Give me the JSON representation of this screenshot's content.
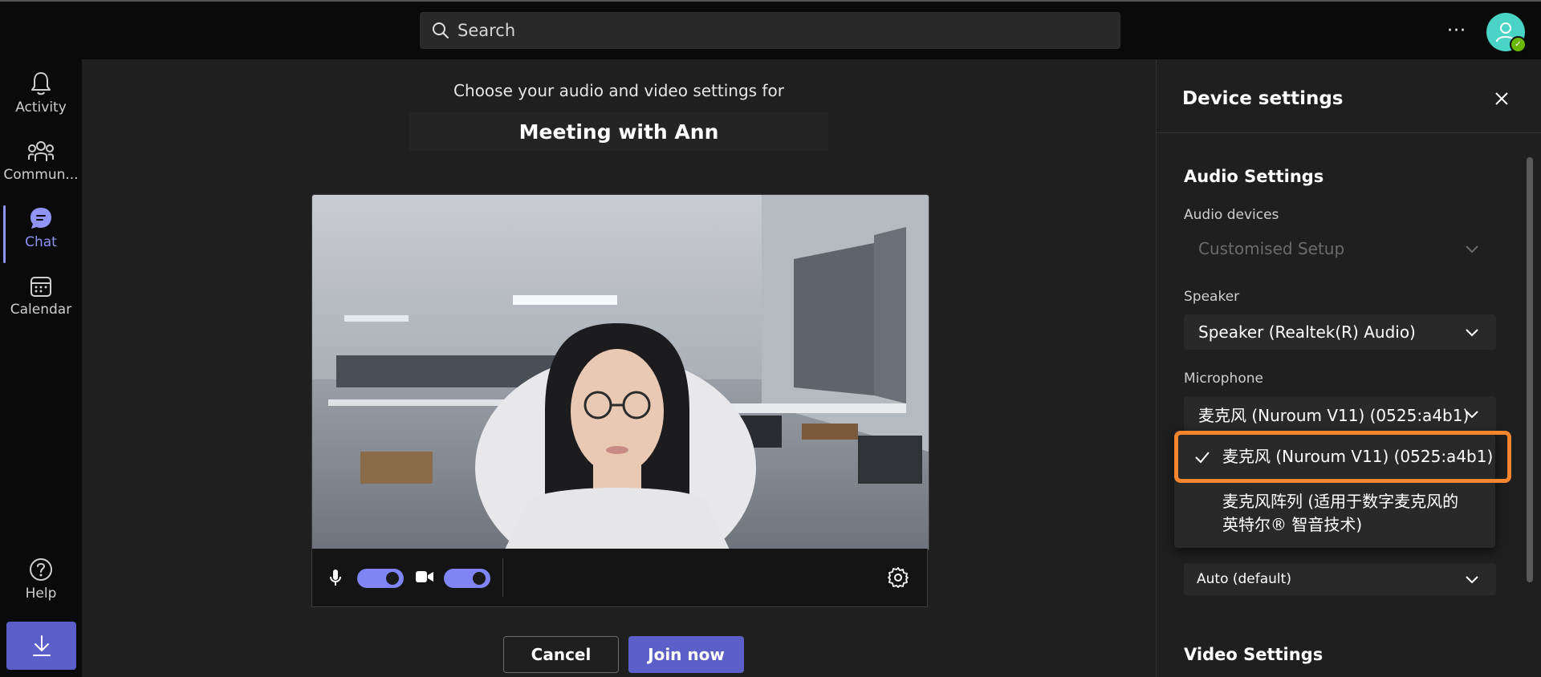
{
  "header": {
    "search_placeholder": "Search",
    "more_label": "···"
  },
  "rail": {
    "items": [
      {
        "label": "Activity",
        "icon": "bell-icon"
      },
      {
        "label": "Commun...",
        "icon": "communities-icon"
      },
      {
        "label": "Chat",
        "icon": "chat-icon",
        "active": true
      },
      {
        "label": "Calendar",
        "icon": "calendar-icon"
      }
    ],
    "help_label": "Help"
  },
  "prejoin": {
    "subtitle": "Choose your audio and video settings for",
    "meeting_title": "Meeting with Ann",
    "cancel_label": "Cancel",
    "join_label": "Join now",
    "mic_on": true,
    "camera_on": true
  },
  "device_settings": {
    "title": "Device settings",
    "audio_section": "Audio Settings",
    "audio_devices_label": "Audio devices",
    "audio_devices_value": "Customised Setup",
    "speaker_label": "Speaker",
    "speaker_value": "Speaker (Realtek(R) Audio)",
    "microphone_label": "Microphone",
    "microphone_value": "麦克风 (Nuroum V11) (0525:a4b1)",
    "noise_value": "Auto (default)",
    "video_section": "Video Settings",
    "microphone_options": [
      {
        "label": "麦克风 (Nuroum V11) (0525:a4b1)",
        "selected": true
      },
      {
        "label_line1": "麦克风阵列 (适用于数字麦克风的",
        "label_line2": "英特尔® 智音技术)",
        "selected": false
      }
    ]
  },
  "colors": {
    "accent": "#5b5fc7",
    "accent_light": "#7f85f5",
    "highlight": "#f7852d"
  }
}
